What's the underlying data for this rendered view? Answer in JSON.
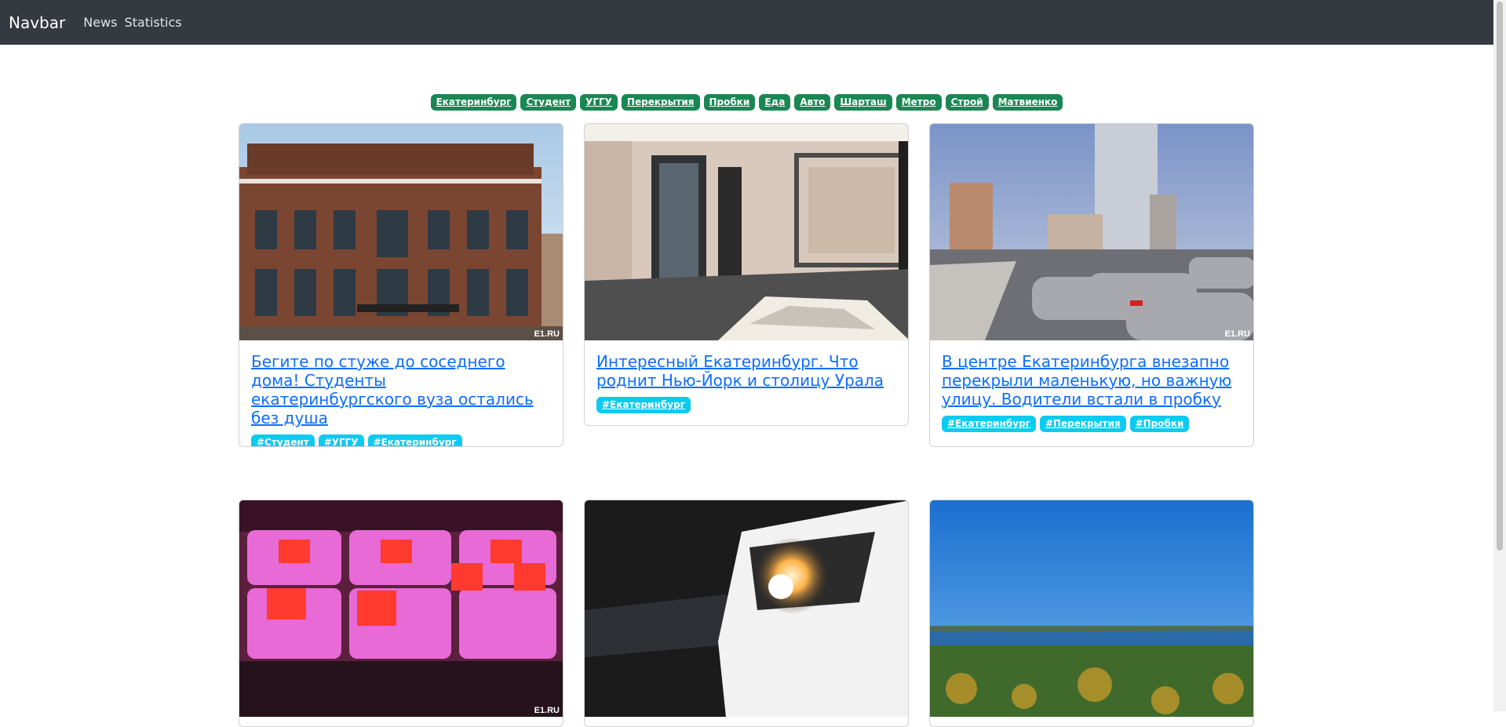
{
  "navbar": {
    "brand": "Navbar",
    "links": [
      "News",
      "Statistics"
    ]
  },
  "filter_tags": [
    "Екатеринбург",
    "Студент",
    "УГГУ",
    "Перекрытия",
    "Пробки",
    "Еда",
    "Авто",
    "Шарташ",
    "Метро",
    "Строй",
    "Матвиенко"
  ],
  "watermark": "E1.RU",
  "cards": [
    {
      "title": "Бегите по стуже до соседнего дома! Студенты екатеринбургского вуза остались без душа",
      "tags": [
        "#Студент",
        "#УГГУ",
        "#Екатеринбург"
      ],
      "image": "building-photo"
    },
    {
      "title": "Интересный Екатеринбург. Что роднит Нью-Йорк и столицу Урала",
      "tags": [
        "#Екатеринбург"
      ],
      "image": "lobby-photo"
    },
    {
      "title": "В центре Екатеринбурга внезапно перекрыли маленькую, но важную улицу. Водители встали в пробку",
      "tags": [
        "#Екатеринбург",
        "#Перекрытия",
        "#Пробки"
      ],
      "image": "traffic-photo"
    },
    {
      "image": "food-counter-photo"
    },
    {
      "image": "car-headlight-photo"
    },
    {
      "image": "lake-forest-photo"
    }
  ],
  "colors": {
    "navbar_bg": "#343a40",
    "filter_tag_bg": "#198754",
    "card_tag_bg": "#0dcaf0",
    "link": "#0d6efd"
  }
}
